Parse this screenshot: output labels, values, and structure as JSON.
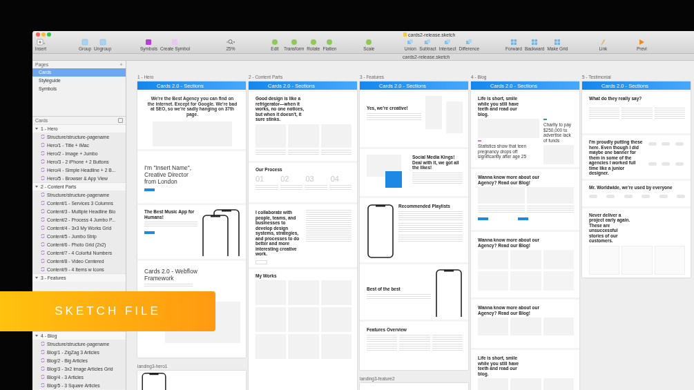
{
  "window": {
    "title": "cards2-release.sketch",
    "document_tab": "cards2-release.sketch"
  },
  "toolbar": [
    {
      "tools": [
        "Insert"
      ]
    },
    {
      "tools": [
        "Group",
        "Ungroup"
      ]
    },
    {
      "tools": [
        "Symbols",
        "Create Symbol"
      ]
    },
    {
      "tools": [
        "25%"
      ]
    },
    {
      "tools": [
        "Edit",
        "Transform",
        "Rotate",
        "Flatten"
      ]
    },
    {
      "tools": [
        "Scale"
      ]
    },
    {
      "tools": [
        "Union",
        "Subtract",
        "Intersect",
        "Difference"
      ]
    },
    {
      "tools": [
        "Forward",
        "Backward",
        "Make Grid"
      ]
    },
    {
      "tools": [
        "Link"
      ]
    },
    {
      "tools": [
        "Previ"
      ]
    }
  ],
  "pages": {
    "title": "Pages",
    "add": "+",
    "items": [
      {
        "label": "Cards",
        "selected": true
      },
      {
        "label": "Styleguide",
        "selected": false
      },
      {
        "label": "Symbols",
        "selected": false
      }
    ]
  },
  "layers": {
    "title": "Cards",
    "groups": [
      {
        "label": "1 - Hero",
        "expanded": true,
        "children": [
          "Structure/structure-pagename",
          "Hero/1 - Title + iMac",
          "Hero/2 - Image + Jumbo",
          "Hero/3 - 2 iPhone + 2 Buttons",
          "Hero/4 - Simple Headline + 2 B...",
          "Hero/5 - Browser & App View"
        ]
      },
      {
        "label": "2 - Content Parts",
        "expanded": true,
        "children": [
          "Structure/structure-pagename",
          "Content/1 - Services 3 Columns",
          "Content/3 - Multiple Headline Bio",
          "Content/2 - Process 4 Jumbo P...",
          "Content/4 - 3x3 My Works Grid",
          "Content/5 - Jumbo Strip",
          "Content/6 - Photo Grid (2x2)",
          "Content/7 - 4 Colorful Numbers",
          "Content/8 - Video Centered",
          "Content/9 - 4 Items w Icons"
        ]
      },
      {
        "label": "3 - Features",
        "expanded": true
      },
      {
        "label": "4 - Blog",
        "expanded": true,
        "children": [
          "Structure/structure-pagename",
          "Blog/1 - ZigZag 3 Articles",
          "Blog/2 - Big Articles",
          "Blog/3 - 3x2 Image Articles Grid",
          "Blog/4 - 3 Articles",
          "Blog/5 - 3 Square Articles"
        ]
      }
    ]
  },
  "columns": [
    {
      "label": "1 - Hero",
      "header": "Cards 2.0 - Sections",
      "sections": [
        {
          "kind": "intro",
          "texts": [
            "We're the Best Agency you can find on the internet. Except for Google. We're bad at SEO, so we're sadly hanging on 37th page."
          ]
        },
        {
          "kind": "headline",
          "texts": [
            "I'm \"Insert Name\", Creative Director from London"
          ]
        },
        {
          "kind": "phones",
          "texts": [
            "The Best Music App for Humans!"
          ]
        },
        {
          "kind": "browser",
          "texts": [
            "Cards 2.0 - Webflow Framework"
          ]
        }
      ],
      "below": {
        "label": "landing3-hero1",
        "kind": "phone"
      }
    },
    {
      "label": "2 - Content Parts",
      "header": "Cards 2.0 - Sections",
      "sections": [
        {
          "kind": "columns",
          "texts": [
            "Good design is like a refrigerator—when it works, no one notices, but when it doesn't, it sure stinks."
          ]
        },
        {
          "kind": "numbers",
          "texts": [
            "Our Process"
          ],
          "numbers": [
            "01",
            "02",
            "03",
            "04"
          ]
        },
        {
          "kind": "split",
          "texts": [
            "I collaborate with people, teams, and businesses to develop design systems, strategies, and processes to do better and more interesting creative work."
          ]
        },
        {
          "kind": "grid",
          "texts": [
            "My Works"
          ]
        }
      ]
    },
    {
      "label": "3 - Features",
      "header": "Cards 2.0 - Sections",
      "sections": [
        {
          "kind": "images",
          "texts": [
            "Yes, we're creative!"
          ]
        },
        {
          "kind": "social",
          "texts": [
            "Social Media Kings! Deal with it, we got all the likes!"
          ]
        },
        {
          "kind": "playlist",
          "texts": [
            "Recommended Playlists"
          ]
        },
        {
          "kind": "phone-right",
          "texts": [
            "Best of the best"
          ]
        },
        {
          "kind": "overview",
          "texts": [
            "Features Overview"
          ]
        }
      ],
      "below": {
        "label": "landing3-feature2",
        "kind": "blank"
      }
    },
    {
      "label": "4 - Blog",
      "header": "Cards 2.0 - Sections",
      "sections": [
        {
          "kind": "articles",
          "texts": [
            "Life is short, smile while you still have teeth and read our blog.",
            "Charity to pay $250,000 to advertise lack of funds",
            "Statistics show that teen pregnancy drops off significantly after age 25"
          ]
        },
        {
          "kind": "articles2",
          "texts": [
            "Wanna know more about our Agency? Read our Blog!"
          ]
        },
        {
          "kind": "articles3",
          "texts": [
            "Wanna know more about our Agency? Read our Blog!"
          ]
        },
        {
          "kind": "articles4",
          "texts": [
            "Wanna know more about our Agency? Read our Blog!"
          ]
        },
        {
          "kind": "articles5",
          "texts": [
            "Life is short, smile while you still have teeth and read our blog."
          ]
        }
      ]
    },
    {
      "label": "5 - Testimonial",
      "header": "Cards 2.0 - Sections",
      "sections": [
        {
          "kind": "quotes",
          "texts": [
            "What do they really say?"
          ]
        },
        {
          "kind": "logos",
          "texts": [
            "I'm proudly putting these here. Even though I did maybe one banner for them in some of the agencies I worked full time like a junior designer."
          ]
        },
        {
          "kind": "logo-row",
          "texts": [
            "Mr. Worldwide, we're used by everyone"
          ]
        },
        {
          "kind": "stories",
          "texts": [
            "Never deliver a project early again. These are unsuccessful stories of our customers."
          ]
        }
      ]
    }
  ],
  "banner": {
    "text": "SKETCH FILE"
  }
}
